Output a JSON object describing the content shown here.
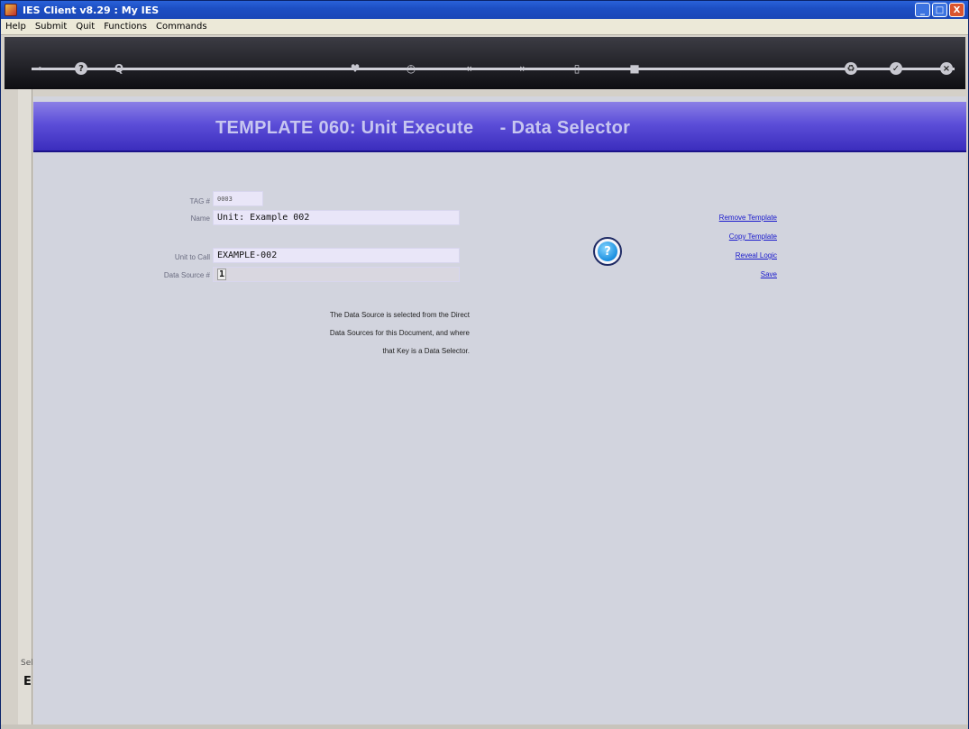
{
  "window": {
    "title": "IES Client v8.29 : My IES",
    "controls": [
      "_",
      "□",
      "X"
    ]
  },
  "menu": [
    "Help",
    "Submit",
    "Quit",
    "Functions",
    "Commands"
  ],
  "toolbar": {
    "icons": [
      "key-icon",
      "help-icon",
      "search-icon",
      "heart-icon",
      "clock-icon",
      "back-icon",
      "forward-icon",
      "page-icon",
      "stop-icon",
      "recycle-icon",
      "ok-icon",
      "close-icon"
    ]
  },
  "banner": {
    "heading": "TEMPLATE 060: Unit Execute     - Data Selector"
  },
  "form": {
    "tag_label": "TAG #",
    "tag_value": "0003",
    "name_label": "Name",
    "name_value": "Unit: Example 002",
    "unit_label": "Unit to Call",
    "unit_value": "EXAMPLE-002",
    "ds_label": "Data Source #",
    "ds_value": "1"
  },
  "note": {
    "line1": "The Data Source is selected from the Direct",
    "line2": "Data Sources for this Document, and where",
    "line3": "that Key is a Data Selector."
  },
  "actions": {
    "remove": "Remove Template",
    "copy": "Copy Template",
    "reveal": "Reveal Logic",
    "save": "Save"
  },
  "sidebar": {
    "label": "Sel",
    "letter": "E"
  }
}
